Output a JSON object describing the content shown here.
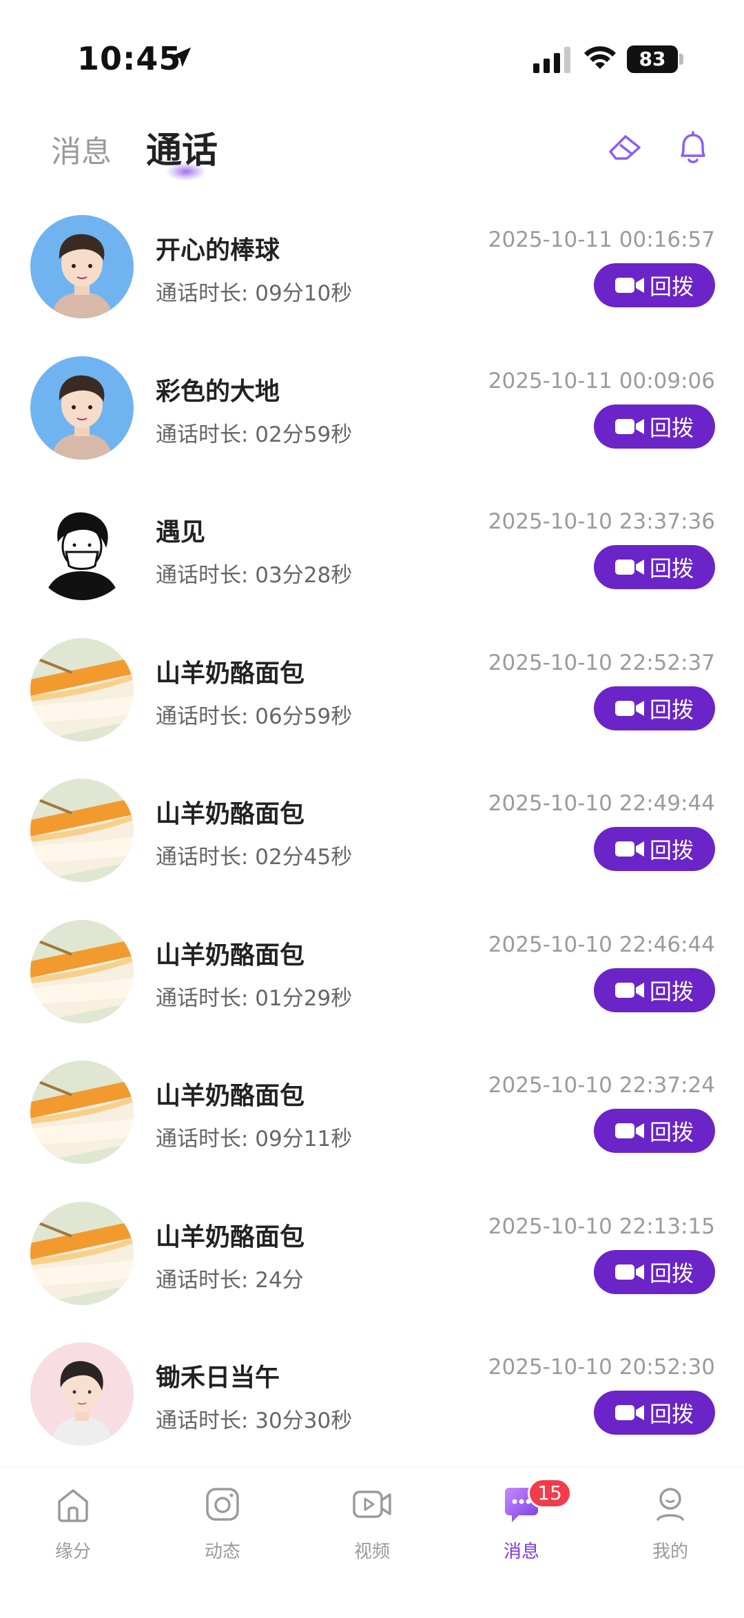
{
  "status_bar": {
    "time": "10:45",
    "battery": "83"
  },
  "header": {
    "tabs": [
      {
        "label": "消息"
      },
      {
        "label": "通话"
      }
    ],
    "active_tab": "通话",
    "accent_color": "#8B5CF6"
  },
  "calls": [
    {
      "name": "开心的棒球",
      "duration": "通话时长: 09分10秒",
      "datetime": "2025-10-11 00:16:57",
      "action": "回拨",
      "avatar": "cartoon-man"
    },
    {
      "name": "彩色的大地",
      "duration": "通话时长: 02分59秒",
      "datetime": "2025-10-11 00:09:06",
      "action": "回拨",
      "avatar": "cartoon-man"
    },
    {
      "name": "遇见",
      "duration": "通话时长: 03分28秒",
      "datetime": "2025-10-10 23:37:36",
      "action": "回拨",
      "avatar": "masked-sketch"
    },
    {
      "name": "山羊奶酪面包",
      "duration": "通话时长: 06分59秒",
      "datetime": "2025-10-10 22:52:37",
      "action": "回拨",
      "avatar": "cake"
    },
    {
      "name": "山羊奶酪面包",
      "duration": "通话时长: 02分45秒",
      "datetime": "2025-10-10 22:49:44",
      "action": "回拨",
      "avatar": "cake"
    },
    {
      "name": "山羊奶酪面包",
      "duration": "通话时长: 01分29秒",
      "datetime": "2025-10-10 22:46:44",
      "action": "回拨",
      "avatar": "cake"
    },
    {
      "name": "山羊奶酪面包",
      "duration": "通话时长: 09分11秒",
      "datetime": "2025-10-10 22:37:24",
      "action": "回拨",
      "avatar": "cake"
    },
    {
      "name": "山羊奶酪面包",
      "duration": "通话时长: 24分",
      "datetime": "2025-10-10 22:13:15",
      "action": "回拨",
      "avatar": "cake"
    },
    {
      "name": "锄禾日当午",
      "duration": "通话时长: 30分30秒",
      "datetime": "2025-10-10 20:52:30",
      "action": "回拨",
      "avatar": "portrait-man"
    }
  ],
  "button_color": "#6A24C8",
  "tab_bar": {
    "items": [
      {
        "label": "缘分",
        "icon": "home-icon"
      },
      {
        "label": "动态",
        "icon": "camera-icon"
      },
      {
        "label": "视频",
        "icon": "video-icon"
      },
      {
        "label": "消息",
        "icon": "chat-icon",
        "badge": "15",
        "active": true
      },
      {
        "label": "我的",
        "icon": "profile-icon"
      }
    ]
  }
}
